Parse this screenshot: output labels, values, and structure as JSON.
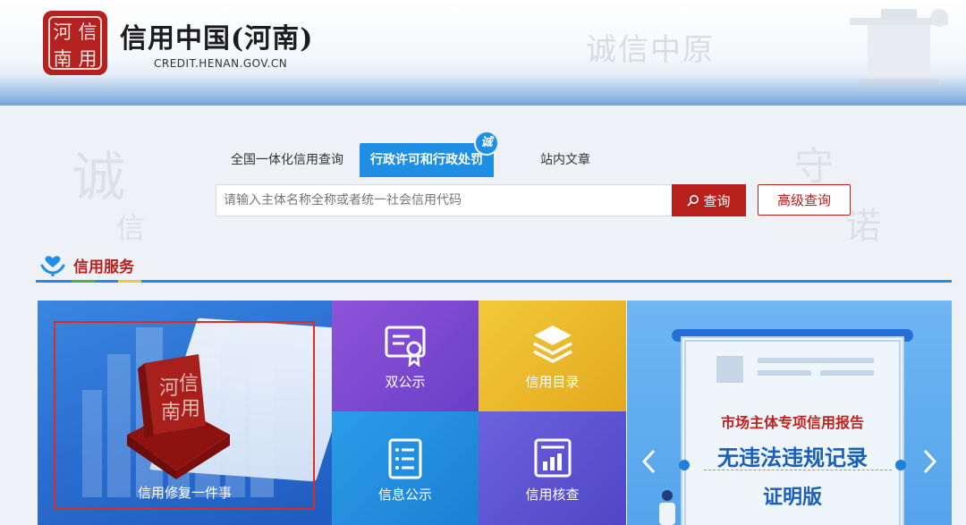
{
  "header": {
    "seal_chars": [
      "河",
      "信",
      "南",
      "用"
    ],
    "site_title": "信用中国(河南)",
    "site_domain": "CREDIT.HENAN.GOV.CN",
    "slogan": "诚信中原"
  },
  "background": {
    "left_chars": [
      "诚",
      "信"
    ],
    "right_chars": [
      "守",
      "诺"
    ]
  },
  "search": {
    "tabs": [
      {
        "label": "全国一体化信用查询",
        "active": false
      },
      {
        "label": "行政许可和行政处罚",
        "active": true,
        "badge": "诚"
      },
      {
        "label": "站内文章",
        "active": false
      }
    ],
    "placeholder": "请输入主体名称全称或者统一社会信用代码",
    "search_label": "查询",
    "advanced_label": "高级查询"
  },
  "section": {
    "title": "信用服务",
    "accent_colors": [
      "#4caf50",
      "#1f8fe6",
      "#f2c93a"
    ]
  },
  "tiles": {
    "repair": {
      "label": "信用修复一件事",
      "stamp_chars": [
        "河",
        "信",
        "南",
        "用"
      ]
    },
    "double_publicity": {
      "label": "双公示"
    },
    "catalog": {
      "label": "信用目录"
    },
    "info_publicity": {
      "label": "信息公示"
    },
    "verification": {
      "label": "信用核查"
    },
    "report": {
      "line1": "市场主体专项信用报告",
      "line2": "无违法违规记录",
      "line3": "证明版"
    }
  },
  "colors": {
    "brand_red": "#b8201c",
    "brand_blue": "#1f8fe6"
  }
}
